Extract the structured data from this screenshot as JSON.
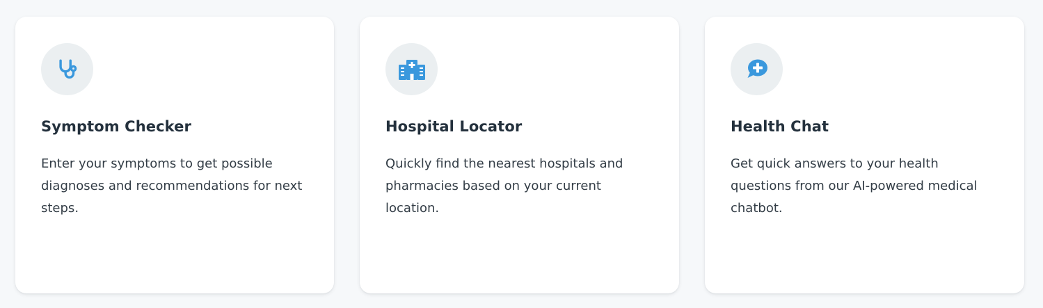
{
  "accent_color": "#3a98dd",
  "features": [
    {
      "icon": "stethoscope-icon",
      "title": "Symptom Checker",
      "description": "Enter your symptoms to get possible diagnoses and recommendations for next steps."
    },
    {
      "icon": "hospital-icon",
      "title": "Hospital Locator",
      "description": "Quickly find the nearest hospitals and pharmacies based on your current location."
    },
    {
      "icon": "medical-chat-icon",
      "title": "Health Chat",
      "description": "Get quick answers to your health questions from our AI-powered medical chatbot."
    }
  ]
}
